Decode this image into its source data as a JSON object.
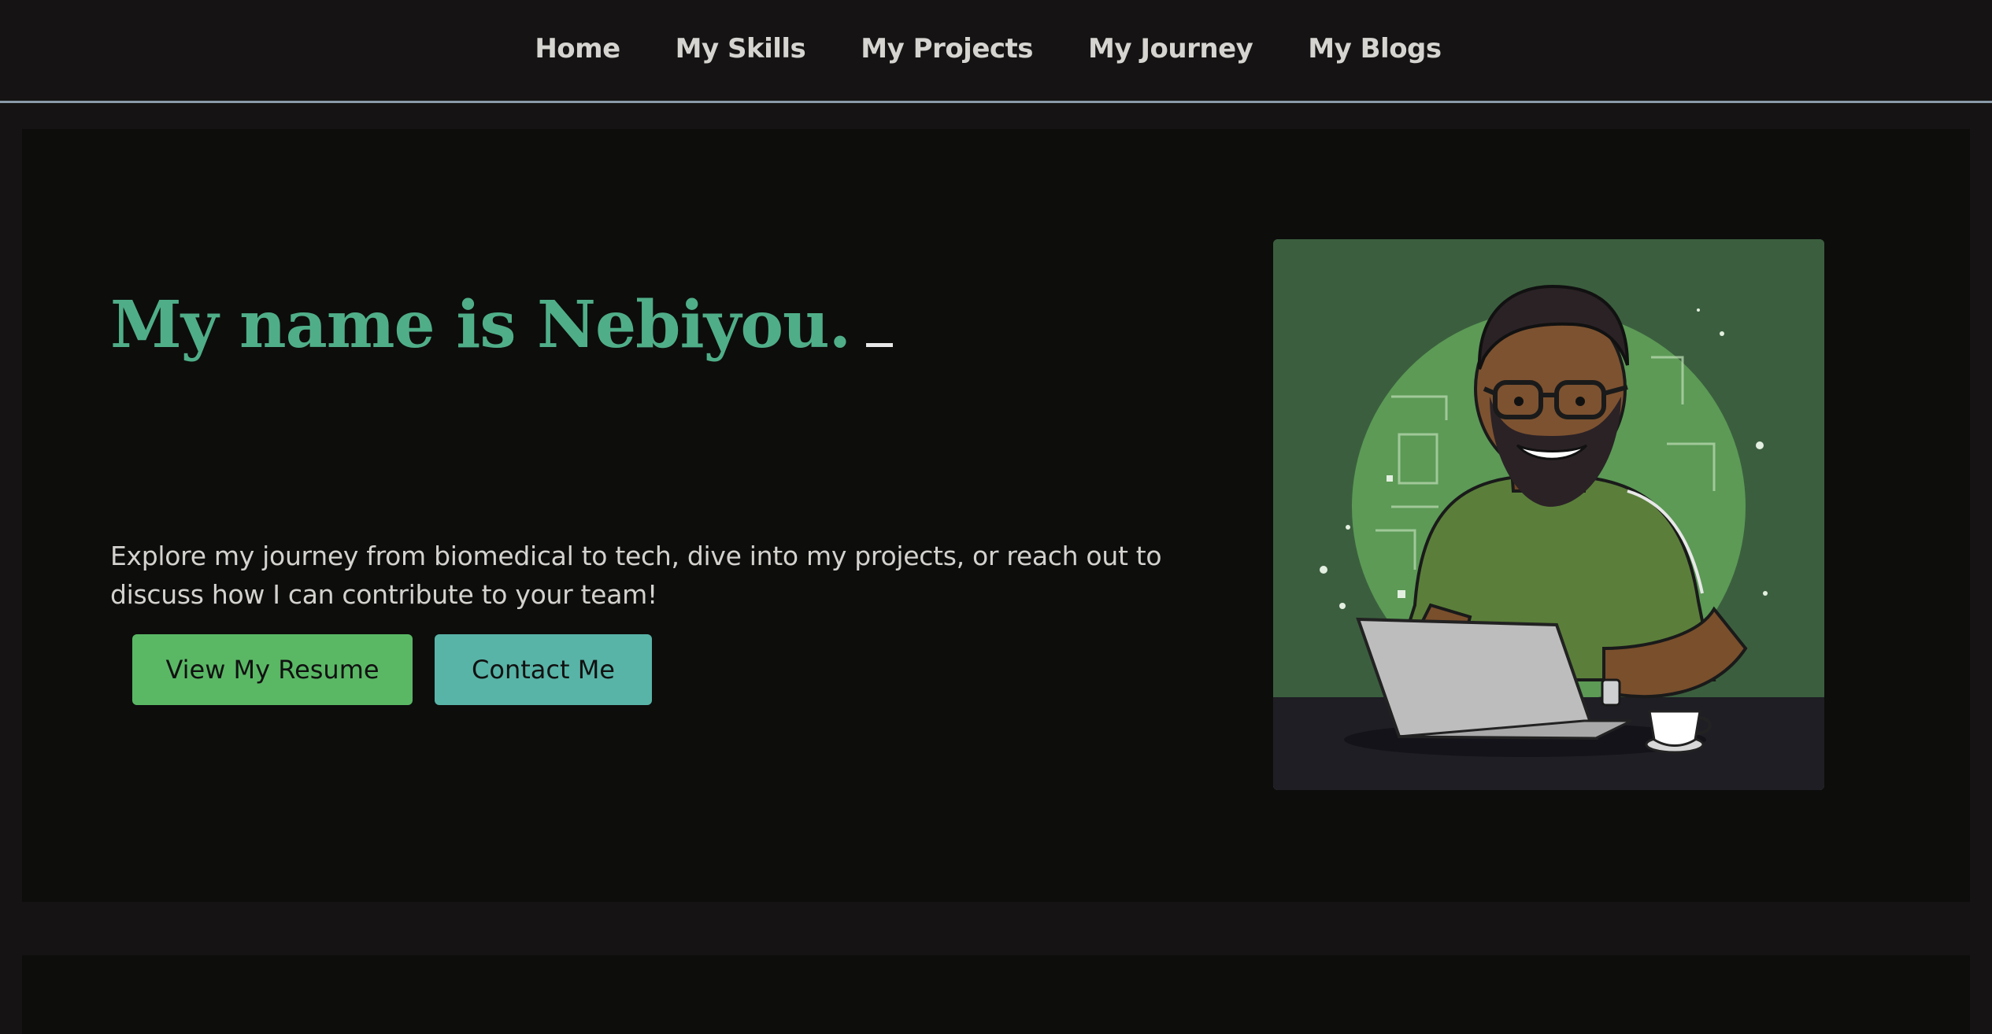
{
  "nav": {
    "items": [
      {
        "label": "Home"
      },
      {
        "label": "My Skills"
      },
      {
        "label": "My Projects"
      },
      {
        "label": "My Journey"
      },
      {
        "label": "My Blogs"
      }
    ]
  },
  "hero": {
    "title": "My name is Nebiyou.",
    "description": "Explore my journey from biomedical to tech, dive into my projects, or reach out to discuss how I can contribute to your team!",
    "buttons": {
      "resume_label": "View My Resume",
      "contact_label": "Contact Me"
    },
    "avatar_icon": "developer-avatar-illustration"
  },
  "colors": {
    "accent": "#4fae88",
    "resume_button": "#5ab865",
    "contact_button": "#58b4a7",
    "background": "#151313",
    "panel": "#0d0d0c"
  }
}
